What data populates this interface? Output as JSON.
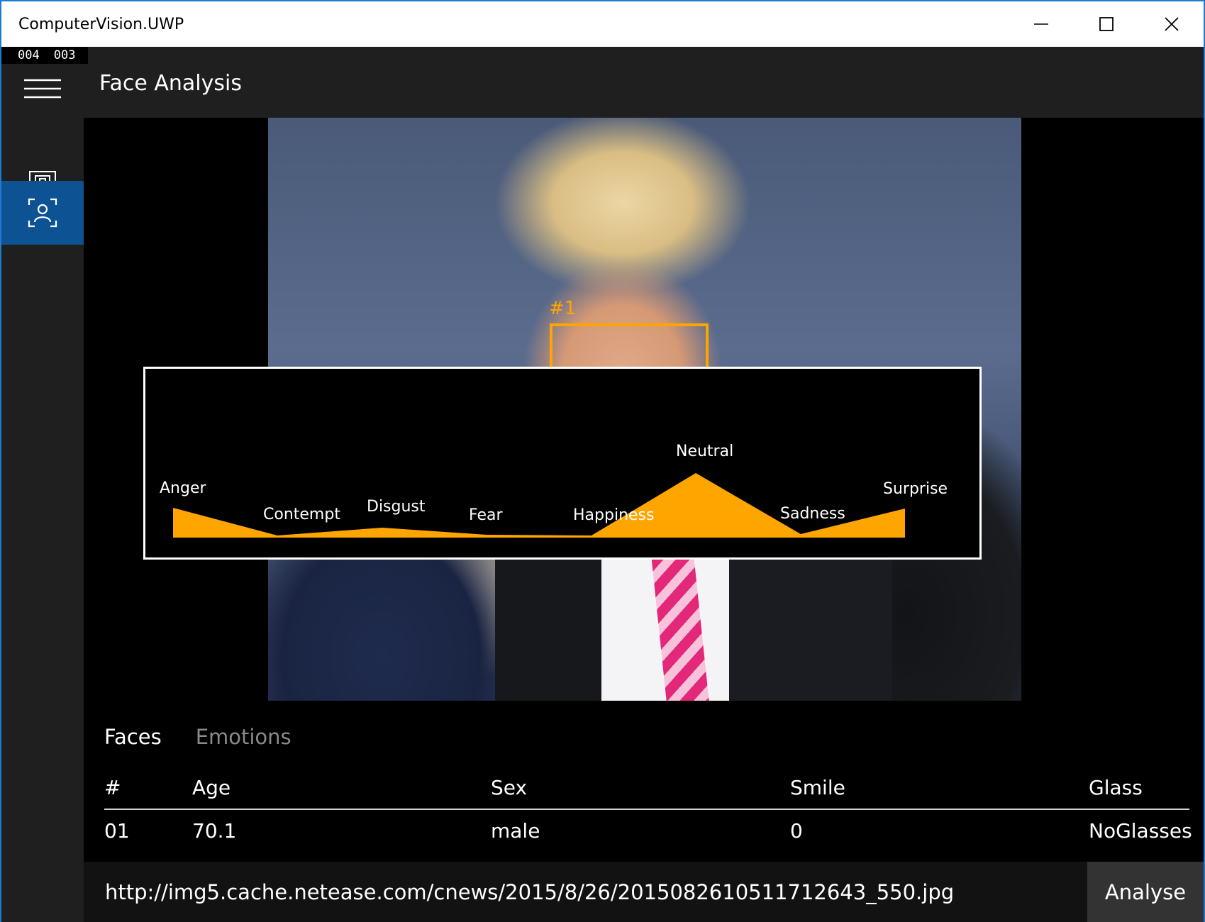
{
  "window": {
    "title": "ComputerVision.UWP"
  },
  "counters": [
    "004",
    "003"
  ],
  "nav": {
    "items": [
      {
        "name": "photo",
        "icon": "image-frame-icon"
      },
      {
        "name": "face",
        "icon": "face-scan-icon",
        "selected": true
      }
    ]
  },
  "header": {
    "title": "Face Analysis"
  },
  "face": {
    "id_label": "#1",
    "box_color": "#ffa500"
  },
  "emotions": {
    "labels": [
      "Anger",
      "Contempt",
      "Disgust",
      "Fear",
      "Happiness",
      "Neutral",
      "Sadness",
      "Surprise"
    ],
    "fill_color": "#ffa500"
  },
  "tabs": [
    {
      "label": "Faces",
      "active": true
    },
    {
      "label": "Emotions",
      "active": false
    }
  ],
  "table": {
    "headers": [
      "#",
      "Age",
      "Sex",
      "Smile",
      "Glass"
    ],
    "rows": [
      [
        "01",
        "70.1",
        "male",
        "0",
        "NoGlasses"
      ]
    ]
  },
  "url": {
    "value": "http://img5.cache.netease.com/cnews/2015/8/26/2015082610511712643_550.jpg"
  },
  "analyse": {
    "label": "Analyse"
  },
  "colors": {
    "accent": "#0d5394",
    "chrome": "#1f1f1f",
    "highlight": "#ffa500"
  }
}
